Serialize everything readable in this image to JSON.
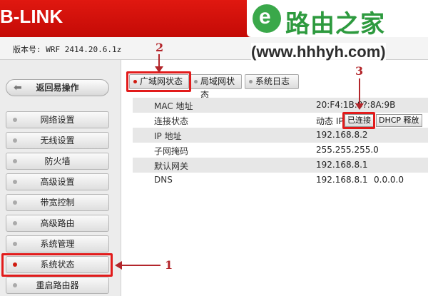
{
  "header": {
    "brand": "B-LINK"
  },
  "watermark": {
    "logo_letter": "e",
    "site_name": "路由之家",
    "url": "(www.hhhyh.com)"
  },
  "version": {
    "text": "版本号: WRF 2414.20.6.1z"
  },
  "sidebar": {
    "back_label": "返回易操作",
    "items": [
      {
        "label": "网络设置"
      },
      {
        "label": "无线设置"
      },
      {
        "label": "防火墙"
      },
      {
        "label": "高级设置"
      },
      {
        "label": "带宽控制"
      },
      {
        "label": "高级路由"
      },
      {
        "label": "系统管理"
      },
      {
        "label": "系统状态"
      },
      {
        "label": "重启路由器"
      }
    ]
  },
  "tabs": [
    {
      "label": "广域网状态"
    },
    {
      "label": "局域网状态"
    },
    {
      "label": "系统日志"
    }
  ],
  "status": {
    "rows": [
      {
        "label": "MAC 地址",
        "value": "20:F4:1B:8?:8A:9B"
      },
      {
        "label": "连接状态",
        "value": "动态 IP"
      },
      {
        "label": "IP 地址",
        "value": "192.168.8.2"
      },
      {
        "label": "子网掩码",
        "value": "255.255.255.0"
      },
      {
        "label": "默认网关",
        "value": "192.168.8.1"
      },
      {
        "label": "DNS",
        "value": "192.168.8.1",
        "value2": "0.0.0.0"
      }
    ],
    "connected_label": "已连接",
    "dhcp_release_label": "DHCP 释放"
  },
  "annotations": {
    "n1": "1",
    "n2": "2",
    "n3": "3"
  },
  "colors": {
    "header_red": "#d01510",
    "annotation_red": "#e21b1b",
    "watermark_green": "#2d9a3e"
  }
}
